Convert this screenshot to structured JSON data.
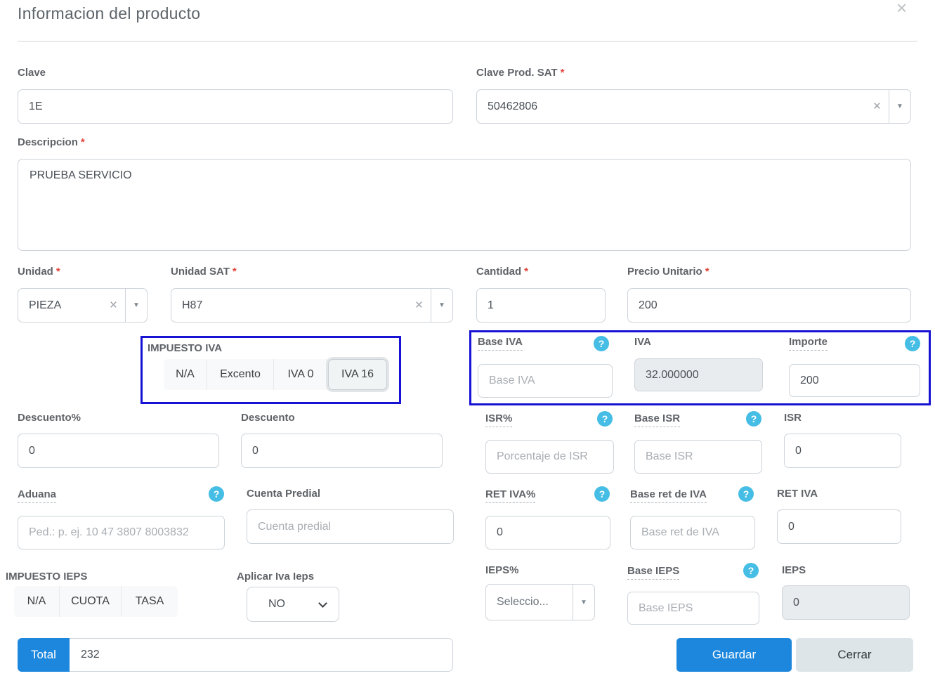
{
  "req": "*",
  "icons": {
    "close": "×",
    "clear": "×",
    "dropdown_arrow": "▼",
    "help": "?"
  },
  "colors": {
    "accent_blue": "#1d87dd",
    "highlight_border": "#1712d4",
    "help_icon": "#45bde4",
    "required": "#e0443a"
  },
  "dialog": {
    "title": "Informacion del producto"
  },
  "form": {
    "clave": {
      "label": "Clave",
      "value": "1E"
    },
    "clave_prod_sat": {
      "label": "Clave Prod. SAT",
      "value": "50462806"
    },
    "descripcion": {
      "label": "Descripcion",
      "value": "PRUEBA SERVICIO"
    },
    "unidad": {
      "label": "Unidad",
      "value": "PIEZA"
    },
    "unidad_sat": {
      "label": "Unidad SAT",
      "value": "H87"
    },
    "cantidad": {
      "label": "Cantidad",
      "value": "1"
    },
    "precio_unitario": {
      "label": "Precio Unitario",
      "value": "200"
    },
    "impuesto_iva": {
      "label": "IMPUESTO IVA",
      "options": [
        "N/A",
        "Excento",
        "IVA 0",
        "IVA 16"
      ],
      "selected": "IVA 16"
    },
    "base_iva": {
      "label": "Base IVA",
      "placeholder": "Base IVA"
    },
    "iva": {
      "label": "IVA",
      "value": "32.000000"
    },
    "importe": {
      "label": "Importe",
      "value": "200"
    },
    "descuento_pct": {
      "label": "Descuento%",
      "value": "0"
    },
    "descuento": {
      "label": "Descuento",
      "value": "0"
    },
    "isr_pct": {
      "label": "ISR%",
      "placeholder": "Porcentaje de ISR"
    },
    "base_isr": {
      "label": "Base ISR",
      "placeholder": "Base ISR"
    },
    "isr": {
      "label": "ISR",
      "value": "0"
    },
    "aduana": {
      "label": "Aduana",
      "placeholder": "Ped.: p. ej. 10 47 3807 8003832"
    },
    "cuenta_predial": {
      "label": "Cuenta Predial",
      "placeholder": "Cuenta predial"
    },
    "ret_iva_pct": {
      "label": "RET IVA%",
      "value": "0"
    },
    "base_ret_iva": {
      "label": "Base ret de IVA",
      "placeholder": "Base ret de IVA"
    },
    "ret_iva": {
      "label": "RET IVA",
      "value": "0"
    },
    "impuesto_ieps": {
      "label": "IMPUESTO IEPS",
      "options": [
        "N/A",
        "CUOTA",
        "TASA"
      ]
    },
    "aplicar_iva_ieps": {
      "label": "Aplicar Iva Ieps",
      "value": "NO"
    },
    "ieps_pct": {
      "label": "IEPS%",
      "value": "Seleccio..."
    },
    "base_ieps": {
      "label": "Base IEPS",
      "placeholder": "Base IEPS"
    },
    "ieps": {
      "label": "IEPS",
      "value": "0"
    },
    "total": {
      "label": "Total",
      "value": "232"
    }
  },
  "buttons": {
    "guardar": "Guardar",
    "cerrar": "Cerrar"
  }
}
